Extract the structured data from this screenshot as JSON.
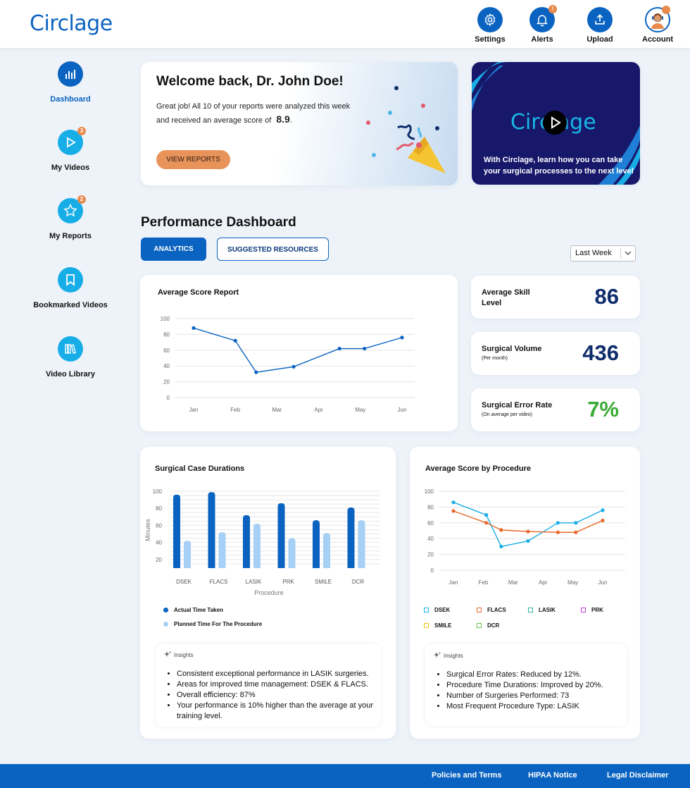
{
  "header": {
    "logo": "Circlage",
    "nav": [
      {
        "label": "Settings",
        "icon": "gear-icon"
      },
      {
        "label": "Alerts",
        "icon": "bell-icon",
        "badge": "!"
      },
      {
        "label": "Upload",
        "icon": "upload-icon"
      },
      {
        "label": "Account",
        "icon": "avatar-icon"
      }
    ]
  },
  "sidebar": {
    "items": [
      {
        "label": "Dashboard",
        "icon": "bar-chart-icon",
        "active": true
      },
      {
        "label": "My Videos",
        "icon": "play-icon",
        "badge": "3"
      },
      {
        "label": "My Reports",
        "icon": "star-icon",
        "badge": "2"
      },
      {
        "label": "Bookmarked Videos",
        "icon": "bookmark-icon"
      },
      {
        "label": "Video Library",
        "icon": "library-icon"
      }
    ]
  },
  "welcome": {
    "title": "Welcome back, Dr. John Doe!",
    "text": "Great job! All 10 of your reports were analyzed this week and received an average score of",
    "score": "8.9",
    "period": ".",
    "button": "VIEW REPORTS"
  },
  "video": {
    "logo": "Circlage",
    "caption": "With Circlage, learn how you can take your surgical processes to the next level"
  },
  "dashboard": {
    "title": "Performance Dashboard",
    "tabs": [
      "ANALYTICS",
      "SUGGESTED RESOURCES"
    ],
    "range": "Last Week"
  },
  "stats": [
    {
      "title": "Average Skill",
      "title2": "Level",
      "sub": "",
      "value": "86",
      "color": "#0f2d6b"
    },
    {
      "title": "Surgical Volume",
      "title2": "",
      "sub": "(Per month)",
      "value": "436",
      "color": "#0f2d6b"
    },
    {
      "title": "Surgical Error Rate",
      "title2": "",
      "sub": "(On average per video)",
      "value": "7%",
      "color": "#3aaa35"
    }
  ],
  "chart_data": [
    {
      "type": "line",
      "title": "Average Score Report",
      "categories": [
        "Jan",
        "Feb",
        "Mar",
        "Apr",
        "May",
        "Jun"
      ],
      "x": [
        0,
        1,
        1.5,
        2.4,
        3.5,
        4.1,
        5
      ],
      "values": [
        88,
        72,
        32,
        39,
        62,
        62,
        76
      ],
      "yticks": [
        0,
        20,
        40,
        60,
        80,
        100
      ],
      "ylim": [
        0,
        100
      ],
      "grid": true,
      "color": "#0a63c0"
    },
    {
      "type": "bar",
      "title": "Surgical Case Durations",
      "categories": [
        "DSEK",
        "FLACS",
        "LASIK",
        "PRK",
        "SMILE",
        "DCR"
      ],
      "xlabel": "Procedure",
      "ylabel": "Minutes",
      "yticks": [
        20,
        40,
        60,
        80,
        100
      ],
      "ylim": [
        10,
        100
      ],
      "series": [
        {
          "name": "Actual Time Taken",
          "color": "#0a63c0",
          "values": [
            96,
            99,
            72,
            86,
            66,
            81
          ]
        },
        {
          "name": "Planned Time For The Procedure",
          "color": "#a6d0f5",
          "values": [
            42,
            52,
            62,
            45,
            51,
            66
          ]
        }
      ]
    },
    {
      "type": "line",
      "title": "Average Score by Procedure",
      "categories": [
        "Jan",
        "Feb",
        "Mar",
        "Apr",
        "May",
        "Jun"
      ],
      "x": [
        0,
        1.1,
        1.6,
        2.5,
        3.5,
        4.1,
        5
      ],
      "yticks": [
        0,
        20,
        40,
        60,
        80,
        100
      ],
      "ylim": [
        0,
        100
      ],
      "series": [
        {
          "color": "#19aee6",
          "x": [
            0,
            1.1,
            1.6,
            2.5,
            3.5,
            4.1,
            5
          ],
          "values": [
            86,
            70,
            30,
            37,
            60,
            60,
            76
          ]
        },
        {
          "color": "#e86a2c",
          "x": [
            0,
            1.1,
            1.6,
            2.5,
            3.5,
            4.1,
            5
          ],
          "values": [
            75,
            60,
            51,
            49,
            48,
            48,
            63
          ]
        }
      ],
      "legend": [
        {
          "name": "DSEK",
          "color": "#19aee6"
        },
        {
          "name": "FLACS",
          "color": "#e86a2c"
        },
        {
          "name": "LASIK",
          "color": "#2bb3a3"
        },
        {
          "name": "PRK",
          "color": "#c23ed8"
        },
        {
          "name": "SMILE",
          "color": "#f0c419"
        },
        {
          "name": "DCR",
          "color": "#6ac04a"
        }
      ]
    }
  ],
  "insights1": {
    "label": "Insights",
    "items": [
      "Consistent exceptional performance in LASIK surgeries.",
      "Areas for improved time management: DSEK & FLACS.",
      "Overall efficiency: 87%",
      "Your performance is 10% higher than the average at your training level."
    ]
  },
  "insights2": {
    "label": "Insights",
    "items": [
      "Surgical Error Rates: Reduced by 12%.",
      "Procedure Time Durations: Improved by 20%.",
      "Number of Surgeries Performed: 73",
      "Most Frequent Procedure Type: LASIK"
    ]
  },
  "footer": {
    "links": [
      "Policies and Terms",
      "HIPAA Notice",
      "Legal Disclaimer"
    ]
  }
}
